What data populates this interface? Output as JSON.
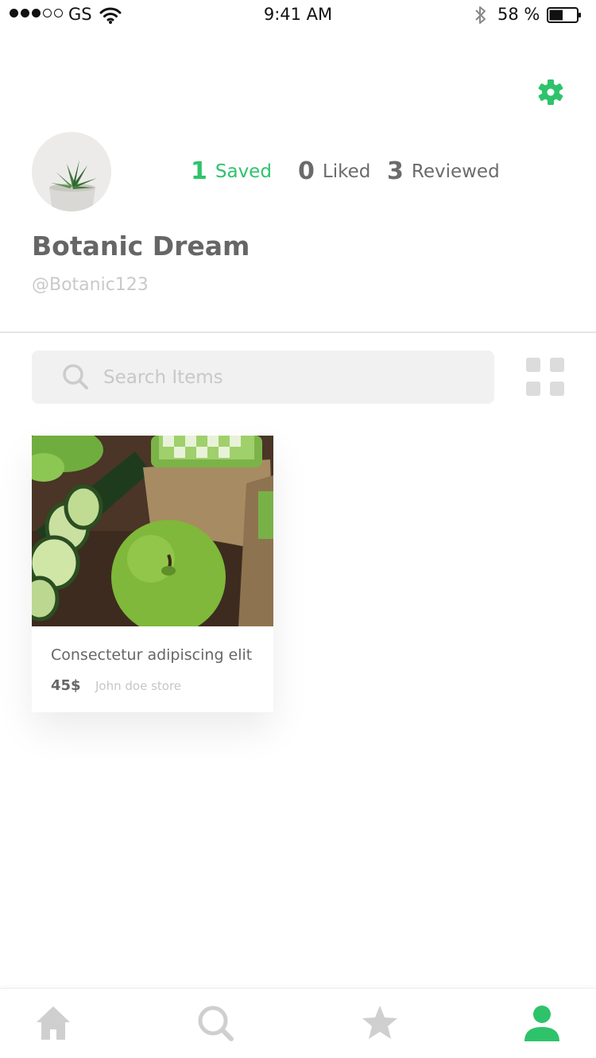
{
  "status_bar": {
    "carrier": "GS",
    "time": "9:41 AM",
    "battery_percent": "58 %",
    "signal_bars_filled": 3,
    "signal_bars_total": 5,
    "battery_level": 0.5
  },
  "profile": {
    "name": "Botanic Dream",
    "handle": "@Botanic123",
    "stats": [
      {
        "count": "1",
        "label": "Saved",
        "active": true
      },
      {
        "count": "0",
        "label": "Liked",
        "active": false
      },
      {
        "count": "3",
        "label": "Reviewed",
        "active": false
      }
    ]
  },
  "search": {
    "placeholder": "Search Items"
  },
  "products": [
    {
      "title": "Consectetur adipiscing elit",
      "price": "45$",
      "store": "John doe store"
    }
  ],
  "tabs": [
    {
      "icon": "home-icon",
      "active": false
    },
    {
      "icon": "search-icon",
      "active": false
    },
    {
      "icon": "star-icon",
      "active": false
    },
    {
      "icon": "profile-icon",
      "active": true
    }
  ],
  "colors": {
    "accent": "#2ec36b",
    "inactive_icon": "#cfcfcf",
    "text": "#666666"
  }
}
